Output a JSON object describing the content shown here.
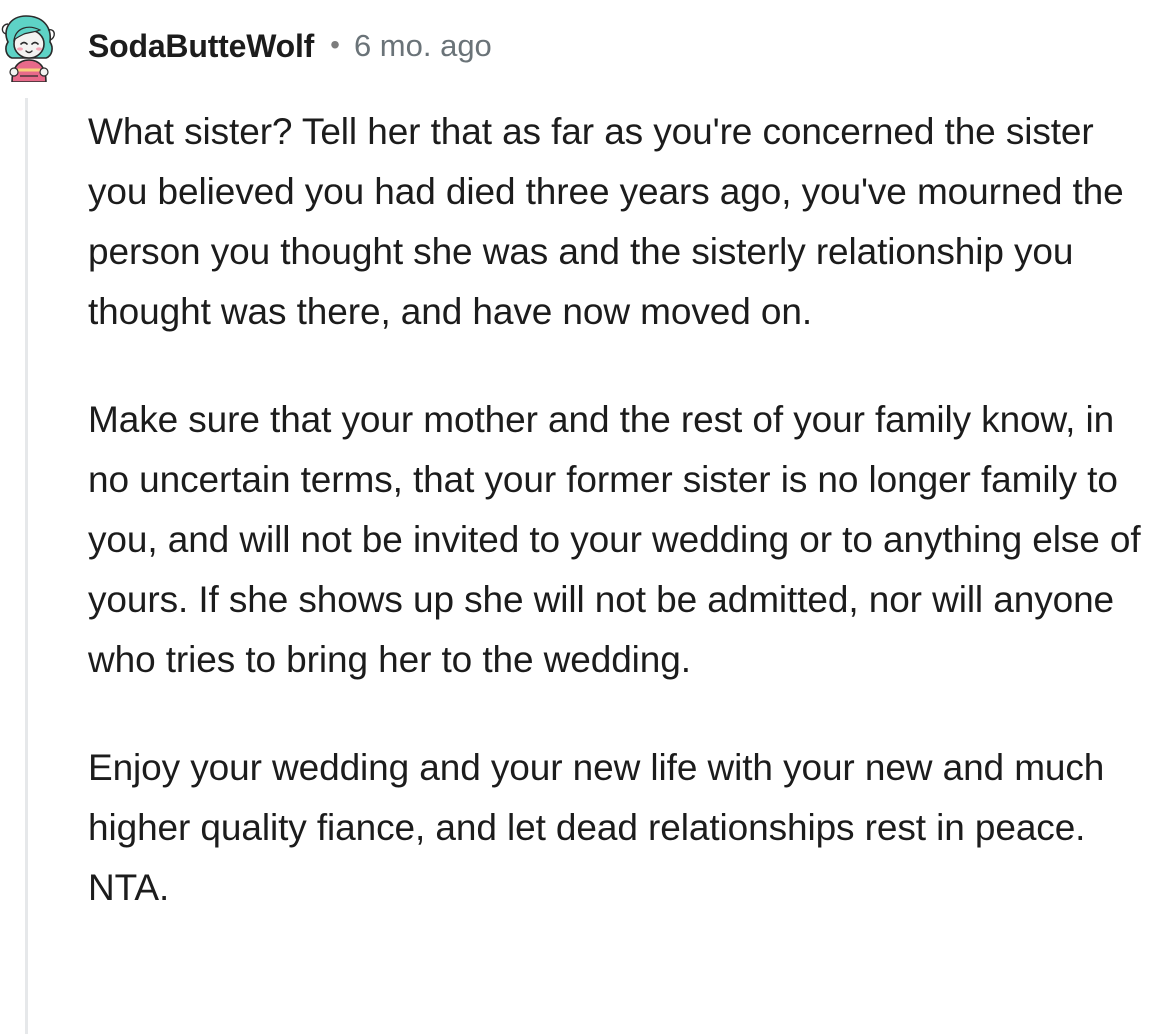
{
  "comment": {
    "author": "SodaButteWolf",
    "separator": "•",
    "timestamp": "6 mo. ago",
    "avatar_icon": "avatar-snoo-icon",
    "paragraphs": [
      "What sister? Tell her that as far as you're concerned the sister you believed you had died three years ago, you've mourned the person you thought she was and the sisterly relationship you thought was there, and have now moved on.",
      "Make sure that your mother and the rest of your family know, in no uncertain terms, that your former sister is no longer family to you, and will not be invited to your wedding or to anything else of yours. If she shows up she will not be admitted, nor will anyone who tries to bring her to the wedding.",
      "Enjoy your wedding and your new life with your new and much higher quality fiance, and let dead relationships rest in peace. NTA."
    ]
  }
}
